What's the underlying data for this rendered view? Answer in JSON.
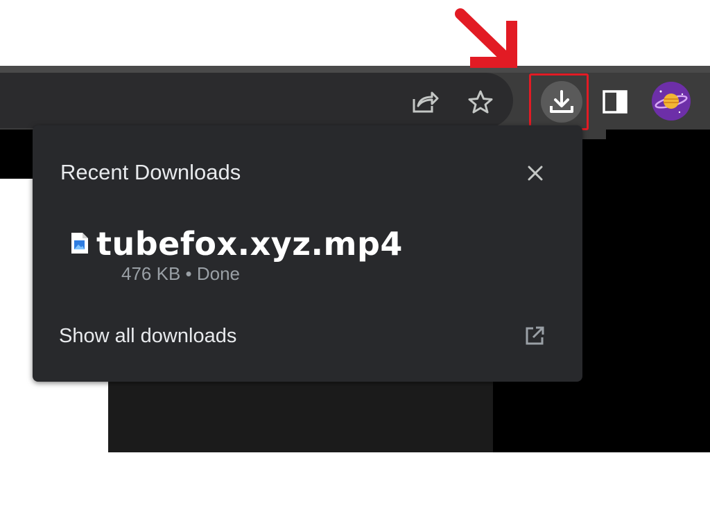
{
  "browser": {
    "toolbar": {
      "share_icon": "share-icon",
      "bookmark_icon": "star-icon",
      "downloads_icon": "download-icon",
      "side_panel_icon": "side-panel-icon",
      "profile_avatar": "avatar"
    },
    "highlight_color": "#e21b24"
  },
  "downloads_popup": {
    "title": "Recent Downloads",
    "close_icon": "close-icon",
    "items": [
      {
        "file_name": "tubefox.xyz.mp4",
        "status": "476 KB • Done",
        "icon": "image-file-icon"
      }
    ],
    "show_all_label": "Show all downloads",
    "open_icon": "open-external-icon"
  }
}
